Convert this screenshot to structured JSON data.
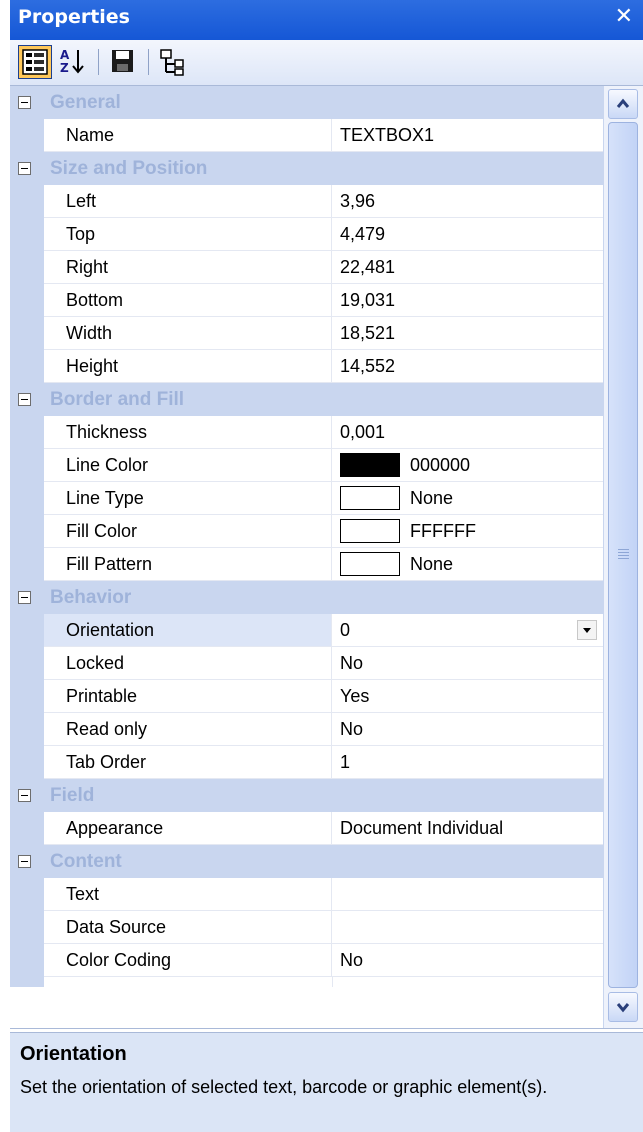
{
  "title": "Properties",
  "close_glyph": "✕",
  "toolbar": {
    "buttons": [
      "categorized-icon",
      "alphabetical-sort-icon",
      "save-icon",
      "tree-icon"
    ]
  },
  "categories": [
    {
      "label": "General",
      "props": [
        {
          "name": "Name",
          "value": "TEXTBOX1"
        }
      ]
    },
    {
      "label": "Size and Position",
      "props": [
        {
          "name": "Left",
          "value": "3,96"
        },
        {
          "name": "Top",
          "value": "4,479"
        },
        {
          "name": "Right",
          "value": "22,481"
        },
        {
          "name": "Bottom",
          "value": "19,031"
        },
        {
          "name": "Width",
          "value": "18,521"
        },
        {
          "name": "Height",
          "value": "14,552"
        }
      ]
    },
    {
      "label": "Border and Fill",
      "props": [
        {
          "name": "Thickness",
          "value": "0,001"
        },
        {
          "name": "Line Color",
          "value": "000000",
          "swatch": "#000000"
        },
        {
          "name": "Line Type",
          "value": "None",
          "swatch": "#ffffff"
        },
        {
          "name": "Fill Color",
          "value": "FFFFFF",
          "swatch": "#ffffff"
        },
        {
          "name": "Fill Pattern",
          "value": "None",
          "swatch": "#ffffff"
        }
      ]
    },
    {
      "label": "Behavior",
      "props": [
        {
          "name": "Orientation",
          "value": "0",
          "selected": true,
          "dropdown": true
        },
        {
          "name": "Locked",
          "value": "No"
        },
        {
          "name": "Printable",
          "value": "Yes"
        },
        {
          "name": "Read only",
          "value": "No"
        },
        {
          "name": "Tab Order",
          "value": "1"
        }
      ]
    },
    {
      "label": "Field",
      "props": [
        {
          "name": "Appearance",
          "value": "Document Individual"
        }
      ]
    },
    {
      "label": "Content",
      "props": [
        {
          "name": "Text",
          "value": ""
        },
        {
          "name": "Data Source",
          "value": ""
        },
        {
          "name": "Color Coding",
          "value": "No"
        }
      ]
    }
  ],
  "description": {
    "title": "Orientation",
    "text": "Set the orientation of selected text, barcode or graphic element(s)."
  },
  "colors": {
    "titlebar": "#1f62dc",
    "category_bg": "#c9d6ef",
    "category_text": "#9fb3da",
    "description_bg": "#dbe5f6"
  }
}
